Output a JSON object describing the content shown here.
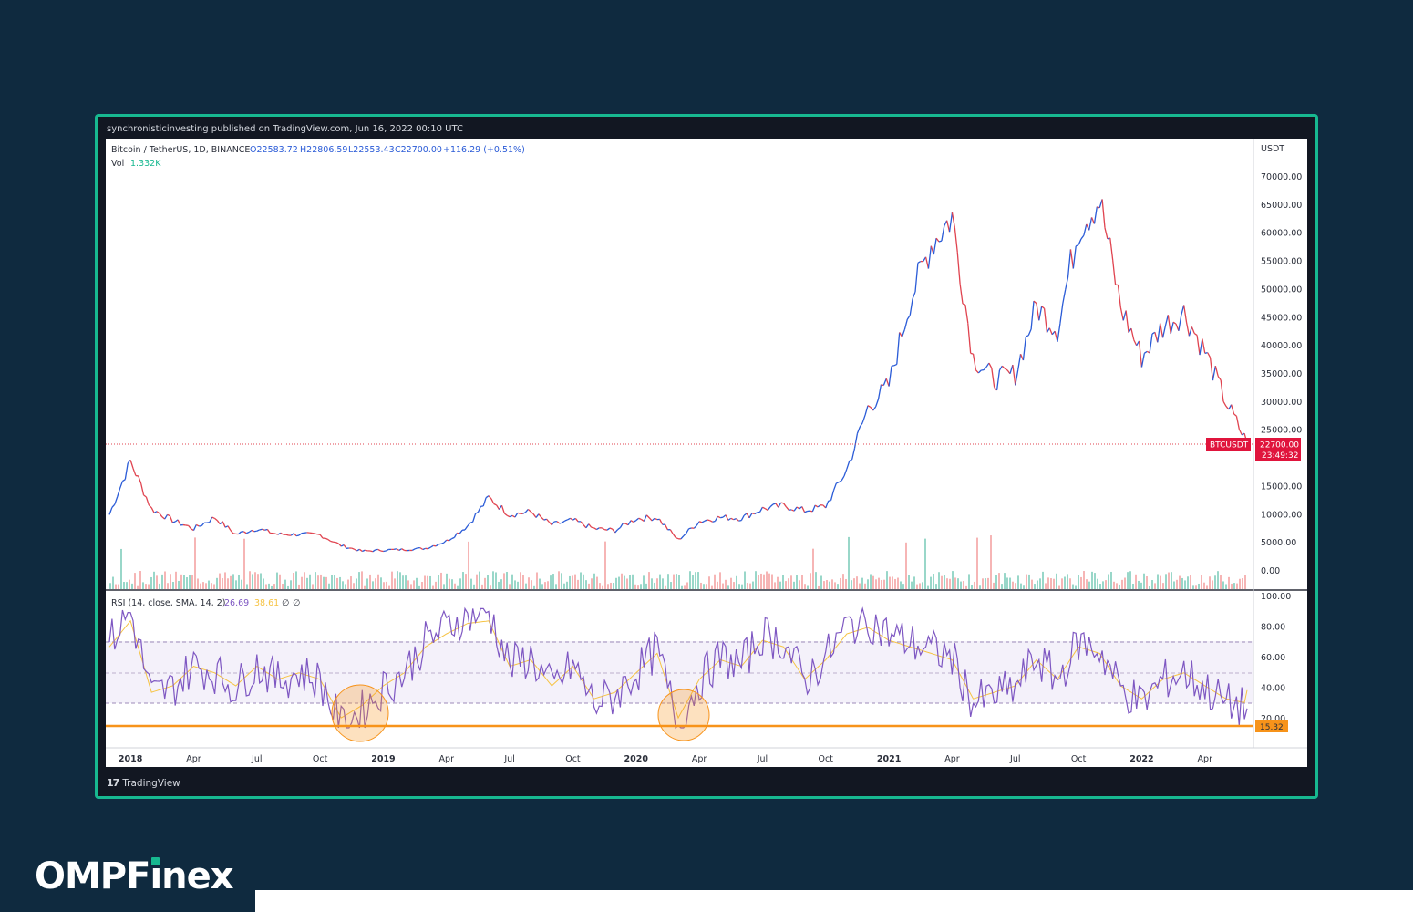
{
  "header": {
    "published": "synchronisticinvesting published on TradingView.com, Jun 16, 2022 00:10 UTC"
  },
  "legend": {
    "symbol": "Bitcoin / TetherUS, 1D, BINANCE",
    "open": "O22583.72",
    "high": "H22806.59",
    "low": "L22553.43",
    "close": "C22700.00",
    "change": "+116.29 (+0.51%)",
    "vol_label": "Vol",
    "vol_value": "1.332K",
    "rsi_label": "RSI (14, close, SMA, 14, 2)",
    "rsi_value": "26.69",
    "rsi_sma": "38.61",
    "rsi_extra1": "∅",
    "rsi_extra2": "∅"
  },
  "price_axis": {
    "currency": "USDT",
    "ticks": [
      "70000.00",
      "65000.00",
      "60000.00",
      "55000.00",
      "50000.00",
      "45000.00",
      "40000.00",
      "35000.00",
      "30000.00",
      "25000.00",
      "15000.00",
      "10000.00",
      "5000.00",
      "0.00"
    ],
    "last_label": "BTCUSDT",
    "last_price": "22700.00",
    "countdown": "23:49:32"
  },
  "rsi_axis": {
    "ticks": [
      "100.00",
      "80.00",
      "60.00",
      "40.00",
      "20.00"
    ],
    "level_label": "15.32"
  },
  "time_axis": {
    "labels": [
      "2018",
      "Apr",
      "Jul",
      "Oct",
      "2019",
      "Apr",
      "Jul",
      "Oct",
      "2020",
      "Apr",
      "Jul",
      "Oct",
      "2021",
      "Apr",
      "Jul",
      "Oct",
      "2022",
      "Apr"
    ]
  },
  "colors": {
    "up": "#2a5bd7",
    "down": "#e0434f",
    "rsi_line": "#7e57c2",
    "rsi_sma": "#f6c343",
    "support_line": "#f7931a",
    "frame_border": "#17b890",
    "brand_accent": "#17b890"
  },
  "chart_data": {
    "type": "line",
    "title": "Bitcoin / TetherUS, 1D, BINANCE",
    "ylabel": "USDT",
    "ylim": [
      0,
      72000
    ],
    "x": [
      "2017-12",
      "2018-01",
      "2018-02",
      "2018-03",
      "2018-04",
      "2018-05",
      "2018-06",
      "2018-07",
      "2018-08",
      "2018-09",
      "2018-10",
      "2018-11",
      "2018-12",
      "2019-01",
      "2019-02",
      "2019-03",
      "2019-04",
      "2019-05",
      "2019-06",
      "2019-07",
      "2019-08",
      "2019-09",
      "2019-10",
      "2019-11",
      "2019-12",
      "2020-01",
      "2020-02",
      "2020-03",
      "2020-04",
      "2020-05",
      "2020-06",
      "2020-07",
      "2020-08",
      "2020-09",
      "2020-10",
      "2020-11",
      "2020-12",
      "2021-01",
      "2021-02",
      "2021-03",
      "2021-04",
      "2021-05",
      "2021-06",
      "2021-07",
      "2021-08",
      "2021-09",
      "2021-10",
      "2021-11",
      "2021-12",
      "2022-01",
      "2022-02",
      "2022-03",
      "2022-04",
      "2022-05",
      "2022-06"
    ],
    "series": [
      {
        "name": "BTCUSDT",
        "values": [
          10000,
          19500,
          11000,
          9000,
          7500,
          9500,
          6500,
          7500,
          6500,
          6500,
          6400,
          4500,
          3500,
          3700,
          3800,
          4000,
          5300,
          8000,
          13000,
          10000,
          10500,
          8200,
          9000,
          7500,
          7200,
          9300,
          9500,
          5500,
          8800,
          9500,
          9400,
          11000,
          11600,
          10700,
          11500,
          18000,
          29000,
          33000,
          48000,
          58000,
          63000,
          38000,
          34000,
          35000,
          47000,
          43000,
          61000,
          66000,
          47000,
          38000,
          43500,
          46000,
          39000,
          30000,
          22700
        ]
      },
      {
        "name": "RSI",
        "values": [
          70,
          90,
          35,
          40,
          55,
          50,
          40,
          55,
          45,
          50,
          45,
          15.32,
          25,
          40,
          50,
          70,
          80,
          88,
          90,
          55,
          60,
          40,
          55,
          30,
          35,
          50,
          65,
          15.32,
          45,
          60,
          55,
          75,
          70,
          45,
          60,
          80,
          85,
          75,
          70,
          65,
          60,
          30,
          35,
          40,
          60,
          45,
          70,
          65,
          40,
          30,
          45,
          50,
          40,
          30,
          26.69
        ]
      }
    ],
    "rsi_bands": [
      30,
      50,
      70
    ],
    "rsi_support_level": 15.32,
    "rsi_sma_last": 38.61,
    "rsi_last": 26.69
  }
}
